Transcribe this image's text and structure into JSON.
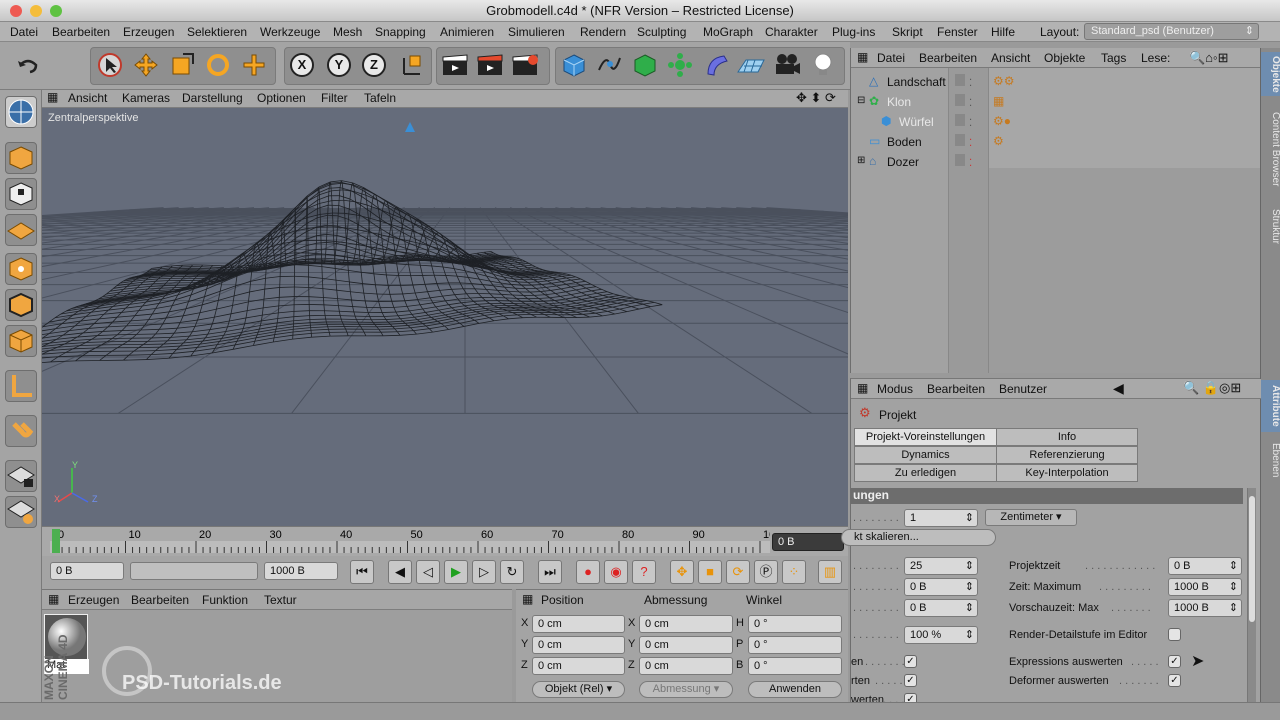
{
  "window": {
    "title": "Grobmodell.c4d * (NFR Version – Restricted License)"
  },
  "menubar": {
    "items": [
      "Datei",
      "Bearbeiten",
      "Erzeugen",
      "Selektieren",
      "Werkzeuge",
      "Mesh",
      "Snapping",
      "Animieren",
      "Simulieren",
      "Rendern",
      "Sculpting",
      "MoGraph",
      "Charakter",
      "Plug-ins",
      "Skript",
      "Fenster",
      "Hilfe"
    ],
    "layout_label": "Layout:",
    "layout_value": "Standard_psd (Benutzer)"
  },
  "toolbar": {
    "axis_x": "X",
    "axis_y": "Y",
    "axis_z": "Z"
  },
  "viewport": {
    "menu": [
      "Ansicht",
      "Kameras",
      "Darstellung",
      "Optionen",
      "Filter",
      "Tafeln"
    ],
    "camera_label": "Zentralperspektive",
    "axis_labels": {
      "y": "Y",
      "x": "X",
      "z": "Z"
    }
  },
  "timeline": {
    "ticks": [
      "0",
      "10",
      "20",
      "30",
      "40",
      "50",
      "60",
      "70",
      "80",
      "90",
      "100"
    ],
    "current_frame": "0 B"
  },
  "transport": {
    "start": "0 B",
    "end": "1000 B"
  },
  "material_manager": {
    "menu": [
      "Erzeugen",
      "Bearbeiten",
      "Funktion",
      "Textur"
    ],
    "material_name": "Mat",
    "watermark": "PSD-Tutorials.de",
    "brand": "MAXON CINEMA 4D"
  },
  "coordinates": {
    "headers": [
      "Position",
      "Abmessung",
      "Winkel"
    ],
    "rows": [
      {
        "pl": "X",
        "pv": "0 cm",
        "sl": "X",
        "sv": "0 cm",
        "al": "H",
        "av": "0 °"
      },
      {
        "pl": "Y",
        "pv": "0 cm",
        "sl": "Y",
        "sv": "0 cm",
        "al": "P",
        "av": "0 °"
      },
      {
        "pl": "Z",
        "pv": "0 cm",
        "sl": "Z",
        "sv": "0 cm",
        "al": "B",
        "av": "0 °"
      }
    ],
    "mode": "Objekt (Rel)",
    "size_mode": "Abmessung",
    "apply": "Anwenden"
  },
  "object_manager": {
    "menu": [
      "Datei",
      "Bearbeiten",
      "Ansicht",
      "Objekte",
      "Tags",
      "Lese:"
    ],
    "objects": [
      {
        "name": "Landschaft",
        "indent": 0,
        "selected": false
      },
      {
        "name": "Klon",
        "indent": 0,
        "selected": false
      },
      {
        "name": "Würfel",
        "indent": 1,
        "selected": false
      },
      {
        "name": "Boden",
        "indent": 0,
        "selected": false
      },
      {
        "name": "Dozer",
        "indent": 0,
        "selected": false
      }
    ]
  },
  "side_tabs": [
    "Objekte",
    "Content Browser",
    "Struktur",
    "Attribute",
    "Ebenen"
  ],
  "attributes": {
    "menu": [
      "Modus",
      "Bearbeiten",
      "Benutzer"
    ],
    "object": "Projekt",
    "tabs": [
      "Projekt-Voreinstellungen",
      "Info",
      "Dynamics",
      "Referenzierung",
      "Zu erledigen",
      "Key-Interpolation"
    ],
    "section": "ungen",
    "scale_value": "1",
    "scale_unit": "Zentimeter",
    "scale_button": "kt skalieren...",
    "fps": "25",
    "min_time": "0 B",
    "preview_min": "0 B",
    "lod": "100 %",
    "project_time_label": "Projektzeit",
    "project_time": "0 B",
    "max_time_label": "Zeit: Maximum",
    "max_time": "1000 B",
    "preview_max_label": "Vorschauzeit: Max",
    "preview_max": "1000 B",
    "render_lod_label": "Render-Detailstufe im Editor",
    "expr_label": "Expressions auswerten",
    "deformer_label": "Deformer auswerten",
    "left_labels": [
      "en",
      "rten",
      "werten"
    ]
  }
}
